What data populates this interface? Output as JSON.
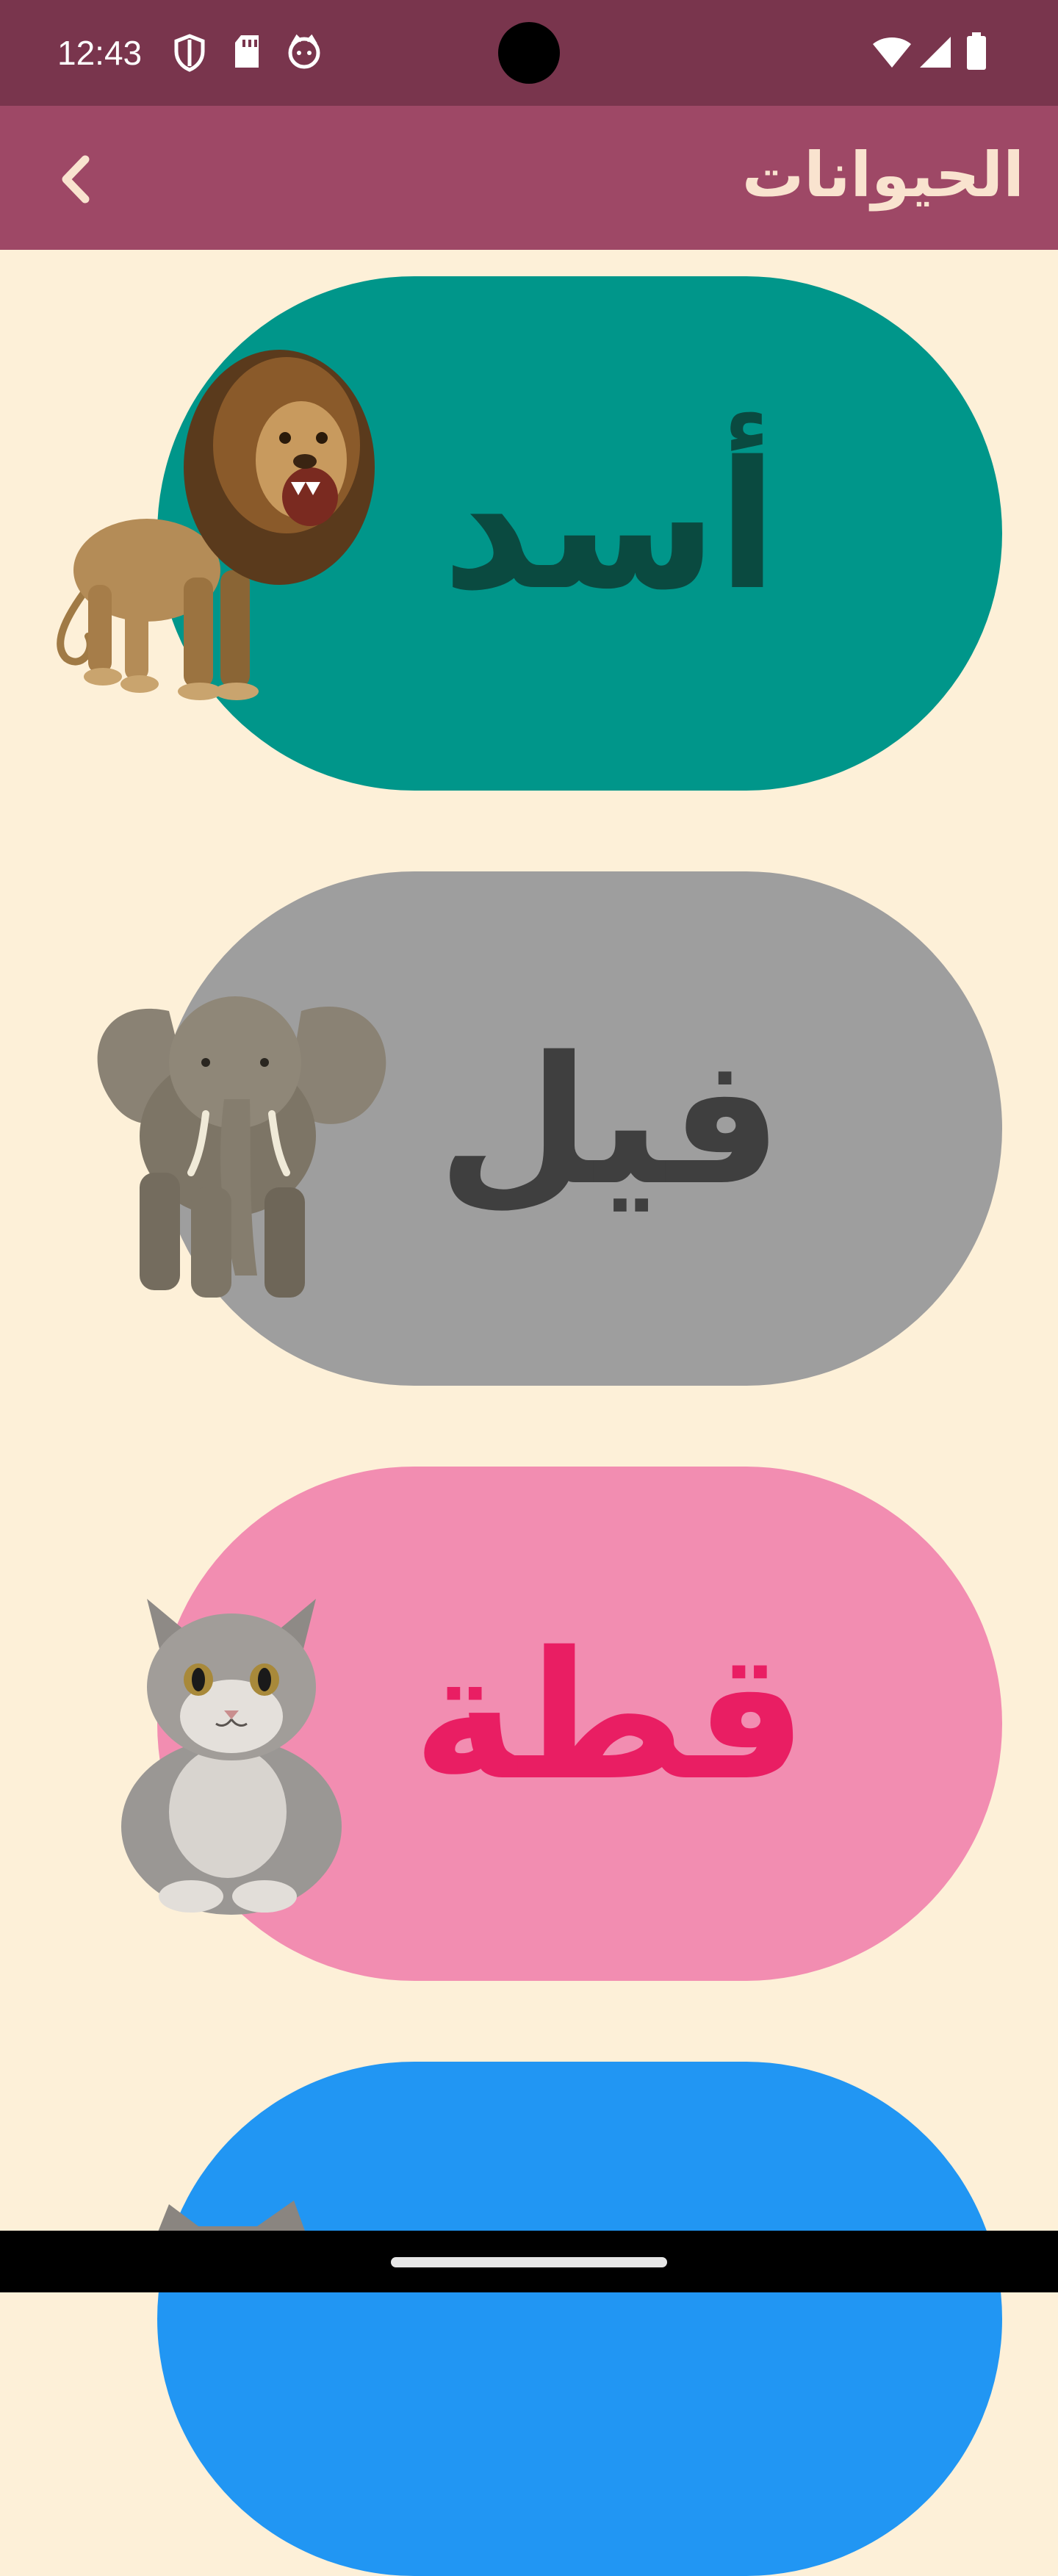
{
  "status_bar": {
    "time": "12:43",
    "icons": [
      "shield-icon",
      "sd-card-icon",
      "face-icon",
      "wifi-icon",
      "signal-icon",
      "battery-icon"
    ]
  },
  "app_bar": {
    "title": "الحيوانات",
    "back_icon": "chevron-left-icon",
    "background": "#9e4866",
    "title_color": "#f9e3cf"
  },
  "animals": [
    {
      "name": "أسد",
      "image": "lion-image",
      "pill_color": "#00968a",
      "text_color": "#0a4a40"
    },
    {
      "name": "فيل",
      "image": "elephant-image",
      "pill_color": "#9e9e9e",
      "text_color": "#3f3f3f"
    },
    {
      "name": "قطة",
      "image": "cat-image",
      "pill_color": "#f28db1",
      "text_color": "#e91e63"
    },
    {
      "name": "",
      "image": "partial-animal-image",
      "pill_color": "#2196f3",
      "text_color": "#0d47a1"
    }
  ],
  "colors": {
    "status_bar": "#79354d",
    "background": "#fdf0d8"
  }
}
